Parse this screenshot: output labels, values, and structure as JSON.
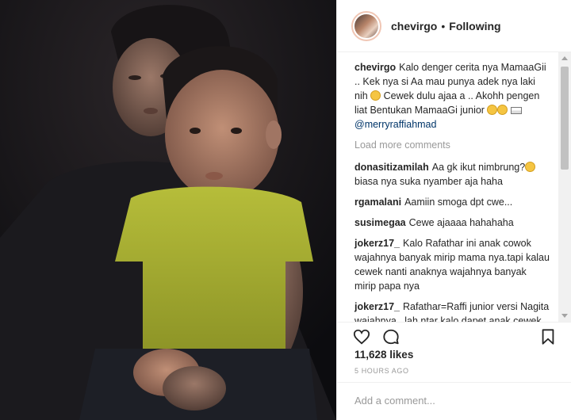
{
  "post": {
    "username": "chevirgo",
    "separator": "•",
    "follow_status": "Following"
  },
  "caption": {
    "user": "chevirgo",
    "text": "Kalo denger cerita nya MamaaGii .. Kek nya si Aa mau punya adek nya laki nih ",
    "text2": " Cewek dulu ajaa a .. Akohh pengen liat Bentukan MamaaGi junior ",
    "mention": "@merryraffiahmad"
  },
  "load_more": "Load more comments",
  "comments": [
    {
      "user": "donasitizamilah",
      "text": "Aa gk ikut nimbrung?",
      "text2": " biasa nya suka nyamber aja haha"
    },
    {
      "user": "rgamalani",
      "text": "Aamiin smoga dpt cwe..."
    },
    {
      "user": "susimegaa",
      "text": "Cewe ajaaaa hahahaha"
    },
    {
      "user": "jokerz17_",
      "text": "Kalo Rafathar ini anak cowok wajahnya banyak mirip mama nya.tapi kalau cewek nanti anaknya wajahnya banyak mirip papa nya"
    },
    {
      "user": "jokerz17_",
      "text": "Rafathar=Raffi junior versi Nagita wajahnya...lah ntar kalo dapet anak cewek berarti Nagita junior versi Raffi wajah hahaha siipp"
    }
  ],
  "icons": {
    "like": "heart-icon",
    "comment": "comment-bubble-icon",
    "save": "bookmark-icon"
  },
  "likes": "11,628 likes",
  "timestamp": "5 HOURS AGO",
  "add_comment": {
    "placeholder": "Add a comment..."
  }
}
